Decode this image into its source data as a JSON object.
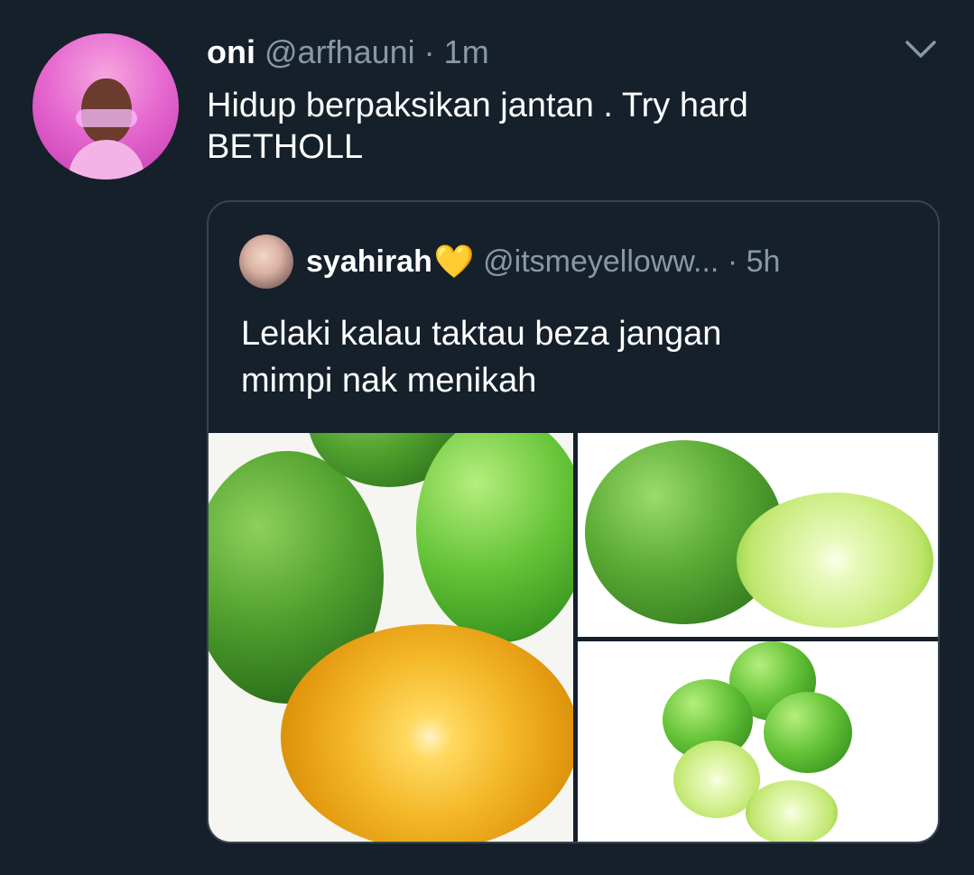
{
  "tweet": {
    "author_name": "oni",
    "author_handle": "@arfhauni",
    "separator": "·",
    "time": "1m",
    "text_lines": [
      "Hidup berpaksikan jantan . Try hard",
      "BETHOLL"
    ]
  },
  "quoted": {
    "author_name": "syahirah",
    "author_emoji": "💛",
    "author_handle": "@itsmeyelloww...",
    "separator": "·",
    "time": "5h",
    "text_lines": [
      "Lelaki kalau taktau beza jangan",
      "mimpi nak menikah"
    ]
  },
  "icons": {
    "menu": "chevron-down-icon",
    "heart": "yellow-heart-icon"
  },
  "colors": {
    "background": "#15202b",
    "secondary_text": "#8899a6",
    "border": "#38444d",
    "emoji": "#f6c12b"
  }
}
